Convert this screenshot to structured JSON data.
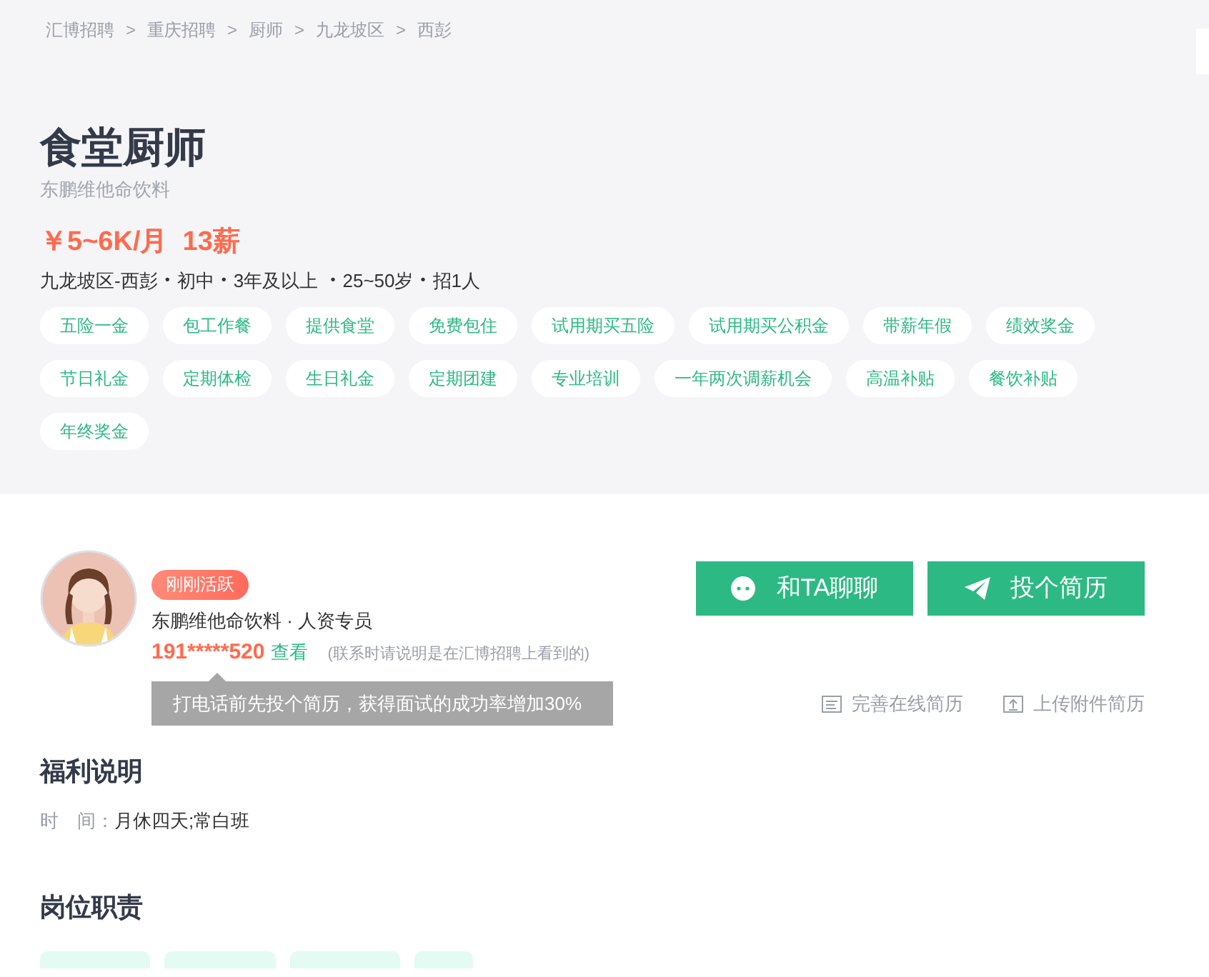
{
  "breadcrumb": [
    {
      "label": "汇博招聘"
    },
    {
      "label": "重庆招聘"
    },
    {
      "label": "厨师"
    },
    {
      "label": "九龙坡区"
    },
    {
      "label": "西彭"
    }
  ],
  "breadcrumb_separator": ">",
  "job": {
    "title": "食堂厨师",
    "company": "东鹏维他命饮料",
    "salary": "￥5~6K/月  13薪",
    "info": [
      "九龙坡区-西彭",
      "初中",
      "3年及以上 ",
      "25~50岁",
      "招1人"
    ],
    "info_separator": "•"
  },
  "benefit_tags": [
    "五险一金",
    "包工作餐",
    "提供食堂",
    "免费包住",
    "试用期买五险",
    "试用期买公积金",
    "带薪年假",
    "绩效奖金",
    "节日礼金",
    "定期体检",
    "生日礼金",
    "定期团建",
    "专业培训",
    "一年两次调薪机会",
    "高温补贴",
    "餐饮补贴",
    "年终奖金"
  ],
  "recruiter": {
    "badge": "刚刚活跃",
    "name": "东鹏维他命饮料 · 人资专员",
    "phone": "191*****520",
    "view_link": "查看",
    "note": "(联系时请说明是在汇博招聘上看到的)",
    "tooltip": "打电话前先投个简历，获得面试的成功率增加30%"
  },
  "actions": [
    {
      "kind": "chat",
      "label": "和TA聊聊"
    },
    {
      "kind": "apply",
      "label": "投个简历"
    }
  ],
  "resume_links": [
    {
      "kind": "online",
      "label": "完善在线简历"
    },
    {
      "kind": "upload",
      "label": "上传附件简历"
    }
  ],
  "sections": [
    {
      "title": "福利说明",
      "fields": [
        {
          "label": "时　间：",
          "value": "月休四天;常白班"
        }
      ]
    },
    {
      "title": "岗位职责"
    }
  ]
}
